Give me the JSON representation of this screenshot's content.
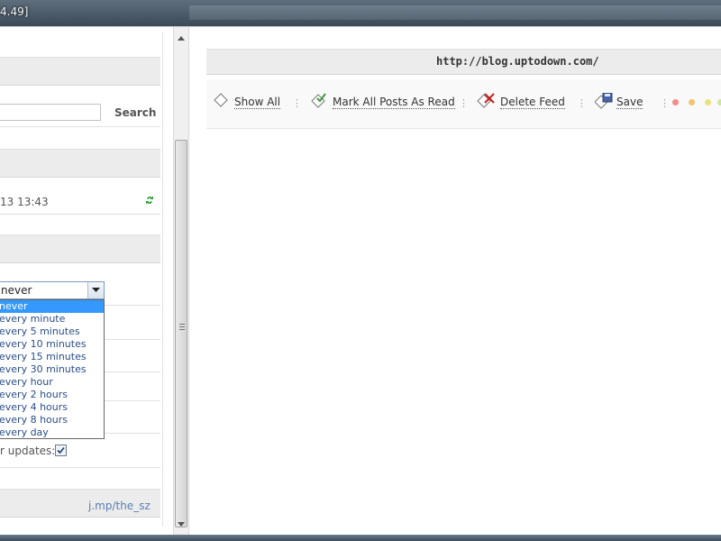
{
  "window": {
    "title": "4.49]"
  },
  "left": {
    "search": {
      "value": "",
      "button": "Search"
    },
    "feed": {
      "updated": "13 13:43"
    },
    "update_interval": {
      "selected": "never",
      "options": [
        "never",
        "every minute",
        "every 5 minutes",
        "every 10 minutes",
        "every 15 minutes",
        "every 30 minutes",
        "every hour",
        "every 2 hours",
        "every 4 hours",
        "every 8 hours",
        "every day"
      ]
    },
    "notify": {
      "label": "r updates:",
      "checked": true
    },
    "footer_link": "j.mp/the_sz"
  },
  "right": {
    "url": "http://blog.uptodown.com/",
    "toolbar": {
      "show_all": "Show All",
      "mark_read": "Mark All Posts As Read",
      "delete_feed": "Delete Feed",
      "save": "Save",
      "sep": "⋮"
    },
    "color_dots": [
      "#f38b8b",
      "#f2c46e",
      "#e9e27a",
      "#cfe3a3"
    ]
  },
  "colors": {
    "accent": "#3399ff",
    "link": "#5a7fb0",
    "refresh": "#2c9a2c"
  }
}
